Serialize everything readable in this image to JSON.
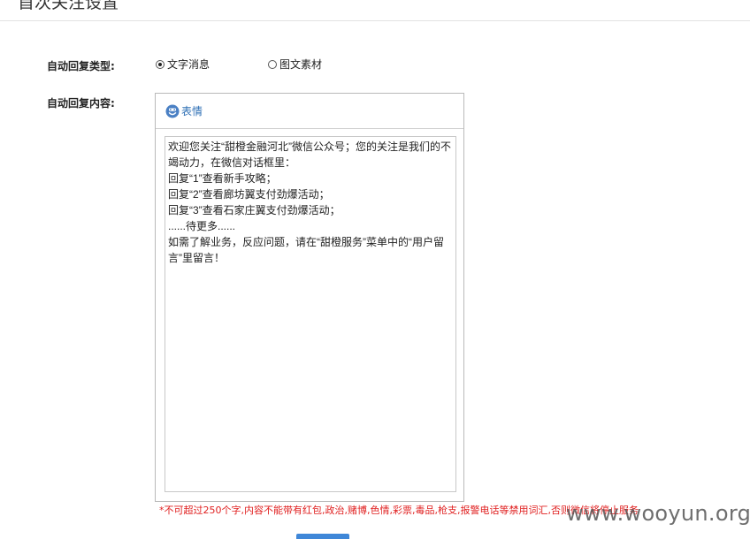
{
  "header": {
    "title": "首次关注设置"
  },
  "form": {
    "reply_type": {
      "label": "自动回复类型:",
      "options": [
        {
          "label": "文字消息",
          "selected": true
        },
        {
          "label": "图文素材",
          "selected": false
        }
      ]
    },
    "reply_content": {
      "label": "自动回复内容:",
      "toolbar": {
        "emoji_label": "表情",
        "emoji_icon": "smiley-face-icon"
      },
      "text": "欢迎您关注“甜橙金融河北”微信公众号；您的关注是我们的不竭动力，在微信对话框里：\n回复“1”查看新手攻略；\n回复“2”查看廊坊翼支付劲爆活动；\n回复“3”查看石家庄翼支付劲爆活动；\n......待更多......\n如需了解业务，反应问题，请在“甜橙服务”菜单中的“用户留言”里留言！"
    },
    "note": "*不可超过250个字,内容不能带有红包,政治,赌博,色情,彩票,毒品,枪支,报警电话等禁用词汇,否则微信将停止服务"
  },
  "watermark": "www.wooyun.org",
  "colors": {
    "link_blue": "#2e6fb5",
    "warning_red": "#e02020",
    "button_blue": "#3f87d8",
    "border_gray": "#b9b9b9"
  }
}
